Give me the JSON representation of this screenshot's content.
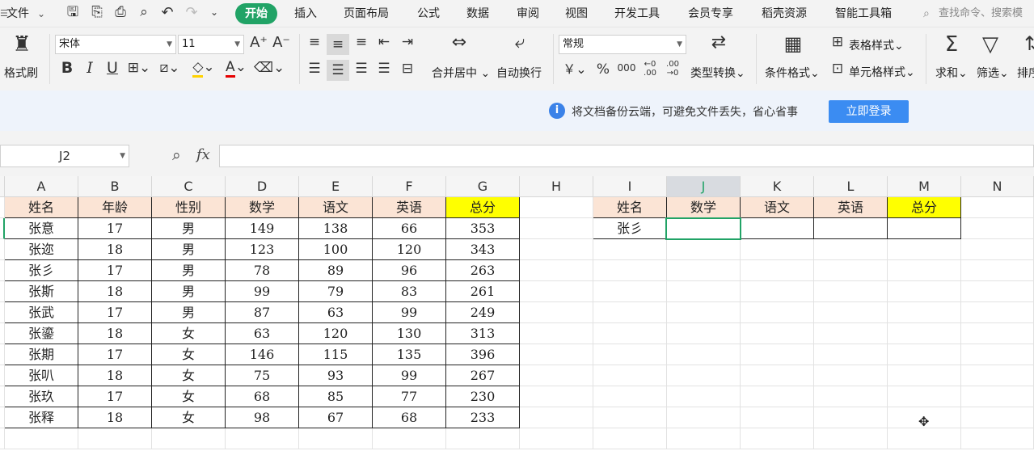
{
  "menubar": {
    "file": "文件",
    "tabs": [
      "开始",
      "插入",
      "页面布局",
      "公式",
      "数据",
      "审阅",
      "视图",
      "开发工具",
      "会员专享",
      "稻壳资源",
      "智能工具箱"
    ],
    "active_tab": "开始",
    "search_placeholder": "查找命令、搜索模"
  },
  "ribbon": {
    "format_painter": "格式刷",
    "font_name": "宋体",
    "font_size": "11",
    "merge_center": "合并居中",
    "wrap_text": "自动换行",
    "number_format": "常规",
    "type_convert": "类型转换",
    "cond_format": "条件格式",
    "table_style": "表格样式",
    "cell_style": "单元格样式",
    "sum": "求和",
    "filter": "筛选",
    "sort": "排序",
    "bold": "B",
    "italic": "I",
    "underline": "U",
    "font_grow": "A⁺",
    "font_shrink": "A⁻",
    "currency": "￥",
    "percent": "%",
    "thousands": "000",
    "inc_decimal": "←0 .00",
    "dec_decimal": ".00 →0"
  },
  "banner": {
    "message": "将文档备份云端，可避免文件丢失，省心省事",
    "login_button": "立即登录"
  },
  "formula_bar": {
    "name_box": "J2",
    "fx": "fx",
    "content": ""
  },
  "colors": {
    "accent": "#21a366",
    "header_fill": "#fbe4d5",
    "total_fill": "#ffff00",
    "login_button": "#3b8cf2"
  },
  "columns": [
    "A",
    "B",
    "C",
    "D",
    "E",
    "F",
    "G",
    "H",
    "I",
    "J",
    "K",
    "L",
    "M",
    "N"
  ],
  "selected_column": "J",
  "main_table": {
    "headers": [
      "姓名",
      "年龄",
      "性别",
      "数学",
      "语文",
      "英语",
      "总分"
    ],
    "rows": [
      [
        "张意",
        "17",
        "男",
        "149",
        "138",
        "66",
        "353"
      ],
      [
        "张迩",
        "18",
        "男",
        "123",
        "100",
        "120",
        "343"
      ],
      [
        "张彡",
        "17",
        "男",
        "78",
        "89",
        "96",
        "263"
      ],
      [
        "张斯",
        "18",
        "男",
        "99",
        "79",
        "83",
        "261"
      ],
      [
        "张武",
        "17",
        "男",
        "87",
        "63",
        "99",
        "249"
      ],
      [
        "张鎏",
        "18",
        "女",
        "63",
        "120",
        "130",
        "313"
      ],
      [
        "张期",
        "17",
        "女",
        "146",
        "115",
        "135",
        "396"
      ],
      [
        "张叭",
        "18",
        "女",
        "75",
        "93",
        "99",
        "267"
      ],
      [
        "张玖",
        "17",
        "女",
        "68",
        "85",
        "77",
        "230"
      ],
      [
        "张释",
        "18",
        "女",
        "98",
        "67",
        "68",
        "233"
      ]
    ]
  },
  "lookup_table": {
    "headers": [
      "姓名",
      "数学",
      "语文",
      "英语",
      "总分"
    ],
    "rows": [
      [
        "张彡",
        "",
        "",
        "",
        ""
      ]
    ]
  }
}
